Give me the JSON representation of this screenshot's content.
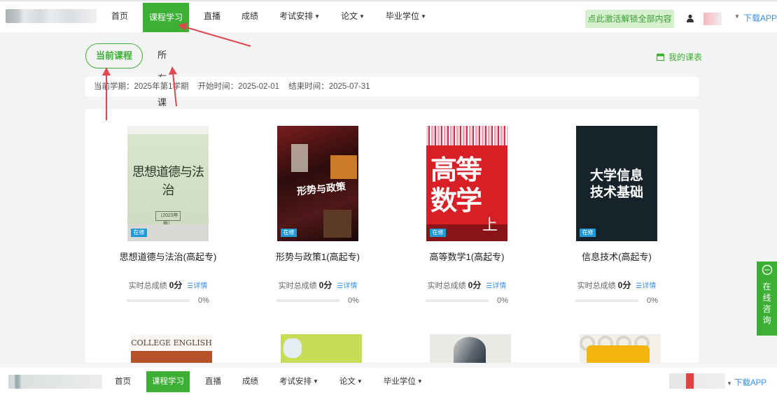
{
  "header": {
    "nav": [
      {
        "label": "首页",
        "active": false,
        "caret": false
      },
      {
        "label": "课程学习",
        "active": true,
        "caret": false
      },
      {
        "label": "直播",
        "active": false,
        "caret": false
      },
      {
        "label": "成绩",
        "active": false,
        "caret": false
      },
      {
        "label": "考试安排",
        "active": false,
        "caret": true
      },
      {
        "label": "论文",
        "active": false,
        "caret": true
      },
      {
        "label": "毕业学位",
        "active": false,
        "caret": true
      }
    ],
    "activate_label": "点此激活解锁全部内容",
    "download_label": "下载APP"
  },
  "tabs": {
    "current": "当前课程",
    "all": "所有课程"
  },
  "schedule_label": "我的课表",
  "term": {
    "semester": "当前学期：2025年第1学期",
    "start": "开始时间：2025-02-01",
    "end": "结束时间：2025-07-31"
  },
  "courses": [
    {
      "title": "思想道德与法治(高起专)",
      "cover_title": "思想道德与法治",
      "cover_year": "（2023年版）",
      "badge": "在修",
      "score_label": "实时总成绩",
      "score": "0分",
      "detail_label": "详情",
      "progress": 0,
      "progress_text": "0%"
    },
    {
      "title": "形势与政策1(高起专)",
      "cover_title": "形势与政策",
      "badge": "在修",
      "score_label": "实时总成绩",
      "score": "0分",
      "detail_label": "详情",
      "progress": 0,
      "progress_text": "0%"
    },
    {
      "title": "高等数学1(高起专)",
      "cover_line1": "高等",
      "cover_line2": "数学",
      "cover_vol": "上",
      "badge": "在修",
      "score_label": "实时总成绩",
      "score": "0分",
      "detail_label": "详情",
      "progress": 0,
      "progress_text": "0%"
    },
    {
      "title": "信息技术(高起专)",
      "cover_line1": "大学信息",
      "cover_line2": "技术基础",
      "badge": "在修",
      "score_label": "实时总成绩",
      "score": "0分",
      "detail_label": "详情",
      "progress": 0,
      "progress_text": "0%"
    }
  ],
  "second_row": {
    "first_cover_text": "COLLEGE ENGLISH"
  },
  "consult": {
    "label_chars": [
      "在",
      "线",
      "咨",
      "询"
    ]
  },
  "bottom_nav": [
    {
      "label": "首页",
      "active": false,
      "caret": false
    },
    {
      "label": "课程学习",
      "active": true,
      "caret": false
    },
    {
      "label": "直播",
      "active": false,
      "caret": false
    },
    {
      "label": "成绩",
      "active": false,
      "caret": false
    },
    {
      "label": "考试安排",
      "active": false,
      "caret": true
    },
    {
      "label": "论文",
      "active": false,
      "caret": true
    },
    {
      "label": "毕业学位",
      "active": false,
      "caret": true
    }
  ],
  "colors": {
    "brand": "#3cb034",
    "link": "#3a8ee6",
    "annotation_arrow": "#e0484f"
  }
}
